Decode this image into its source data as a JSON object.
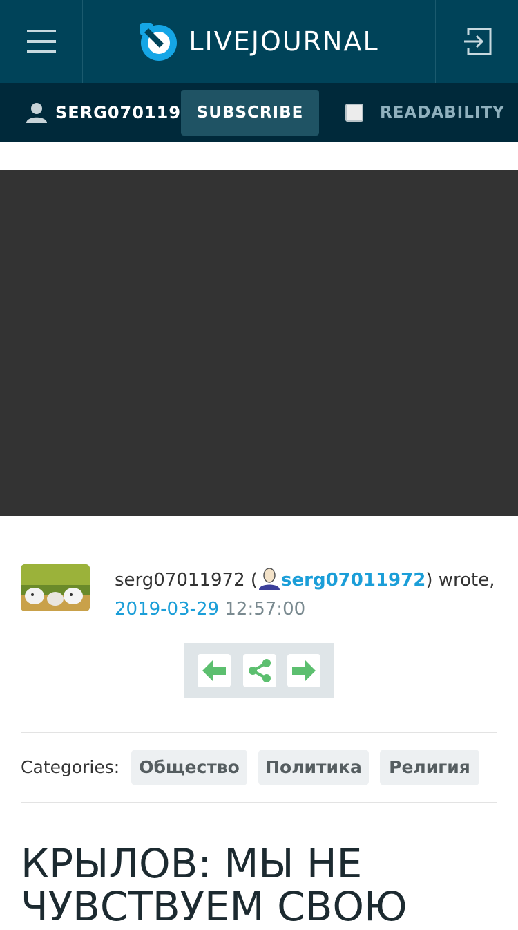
{
  "header": {
    "logo_text": "LIVEJOURNAL",
    "brand_color": "#004359",
    "subbar_color": "#00293a",
    "accent_color": "#1b9ed8",
    "menu_icon": "hamburger-menu-icon",
    "login_icon": "login-icon"
  },
  "subbar": {
    "username": "SERG070119...",
    "subscribe_label": "SUBSCRIBE",
    "readability_label": "READABILITY",
    "readability_checked": false
  },
  "entry": {
    "author_plain": "serg07011972",
    "author_link": "serg07011972",
    "wrote_text": "wrote,",
    "date": "2019-03-29",
    "time": "12:57:00"
  },
  "nav": {
    "prev_icon": "arrow-left-icon",
    "share_icon": "share-icon",
    "next_icon": "arrow-right-icon"
  },
  "categories": {
    "label": "Categories:",
    "items": [
      "Общество",
      "Политика",
      "Религия"
    ]
  },
  "post": {
    "title": "КРЫЛОВ: МЫ НЕ ЧУВСТВУЕМ СВОЮ"
  }
}
